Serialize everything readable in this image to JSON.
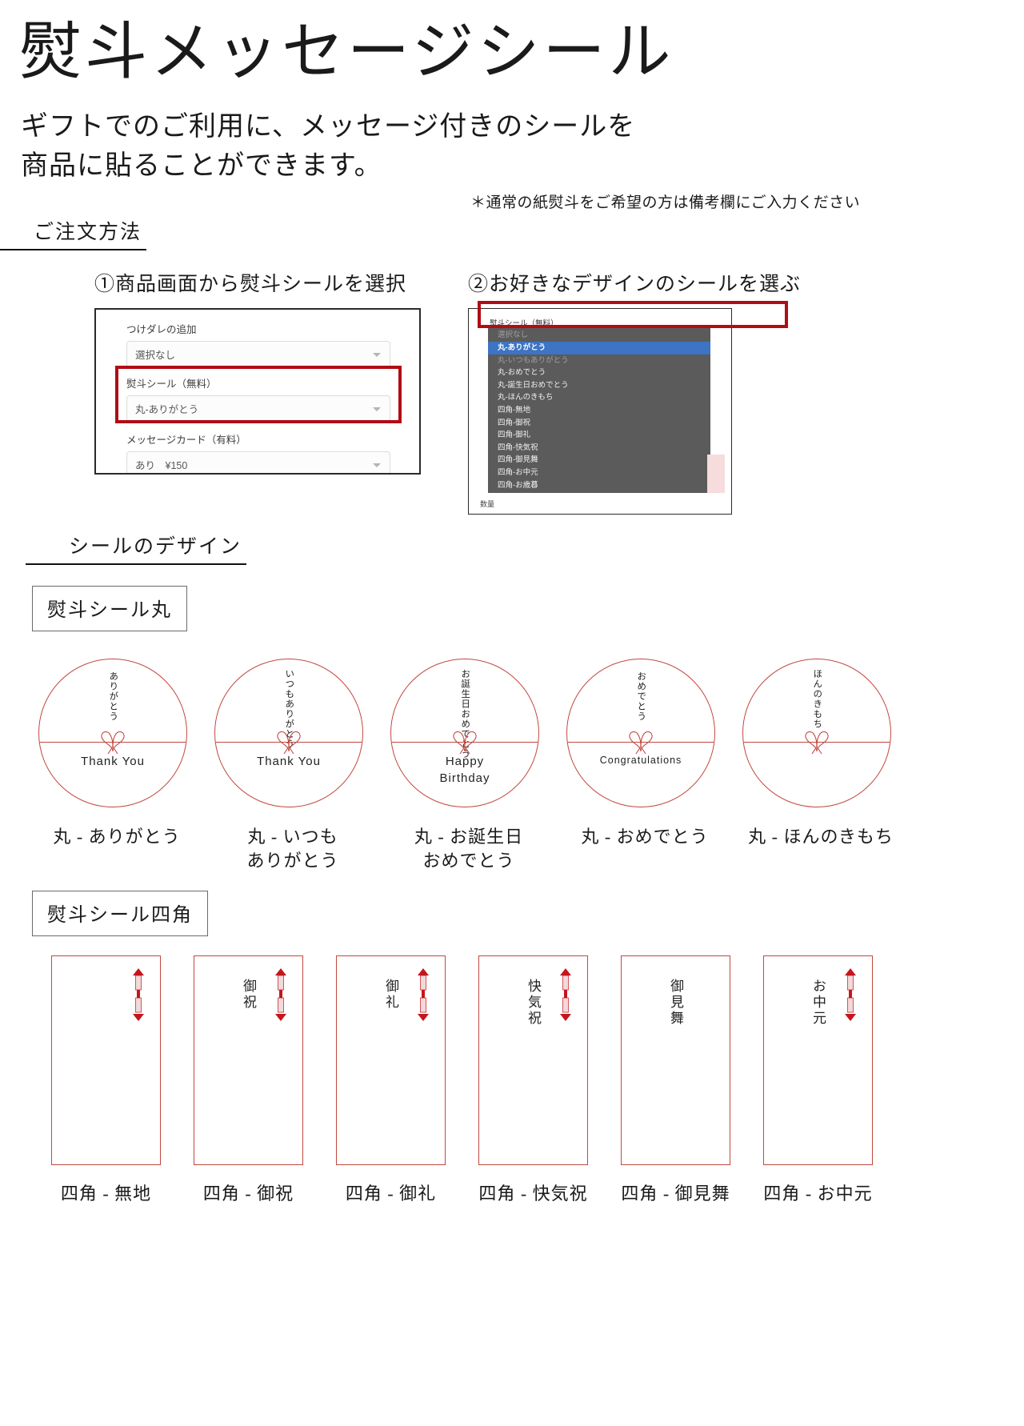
{
  "header": {
    "title": "熨斗メッセージシール",
    "lead_line1": "ギフトでのご利用に、メッセージ付きのシールを",
    "lead_line2": "商品に貼ることができます。",
    "note": "＊通常の紙熨斗をご希望の方は備考欄にご入力ください"
  },
  "sections": {
    "order_method": "ご注文方法",
    "sticker_design": "シールのデザイン"
  },
  "steps": [
    {
      "label": "①商品画面から熨斗シールを選択"
    },
    {
      "label": "②お好きなデザインのシールを選ぶ"
    }
  ],
  "screenshot1": {
    "fields": [
      {
        "label": "つけダレの追加",
        "value": "選択なし"
      },
      {
        "label": "熨斗シール（無料）",
        "value": "丸-ありがとう"
      },
      {
        "label": "メッセージカード（有料）",
        "value": "あり　¥150"
      }
    ]
  },
  "screenshot2": {
    "field_label": "熨斗シール（無料）",
    "options": [
      "選択なし",
      "丸-ありがとう",
      "丸-いつもありがとう",
      "丸-おめでとう",
      "丸-誕生日おめでとう",
      "丸-ほんのきもち",
      "四角-無地",
      "四角-御祝",
      "四角-御礼",
      "四角-快気祝",
      "四角-御見舞",
      "四角-お中元",
      "四角-お歳暮"
    ],
    "selected": "丸-ありがとう",
    "footer": "数量"
  },
  "circle_group": {
    "tag": "熨斗シール丸",
    "items": [
      {
        "top": "ありがとう",
        "message": "Thank You",
        "caption": "丸 - ありがとう"
      },
      {
        "top": "いつもありがとう",
        "message": "Thank You",
        "caption": "丸 - いつも\nありがとう"
      },
      {
        "top": "お誕生日おめでとう",
        "message": "Happy\nBirthday",
        "caption": "丸 - お誕生日\nおめでとう"
      },
      {
        "top": "おめでとう",
        "message": "Congratulations",
        "caption": "丸 - おめでとう"
      },
      {
        "top": "ほんのきもち",
        "message": "",
        "caption": "丸 - ほんのきもち"
      }
    ]
  },
  "square_group": {
    "tag": "熨斗シール四角",
    "items": [
      {
        "text": "",
        "caption": "四角 - 無地"
      },
      {
        "text": "御祝",
        "caption": "四角 - 御祝"
      },
      {
        "text": "御礼",
        "caption": "四角 - 御礼"
      },
      {
        "text": "快気祝",
        "caption": "四角 - 快気祝"
      },
      {
        "text": "御見舞",
        "caption": "四角 - 御見舞",
        "no_noshi": true
      },
      {
        "text": "お中元",
        "caption": "四角 - お中元"
      }
    ]
  },
  "colors": {
    "accent_red": "#b00d15",
    "sticker_red": "#c1483f",
    "highlight_blue": "#3d74c4"
  }
}
